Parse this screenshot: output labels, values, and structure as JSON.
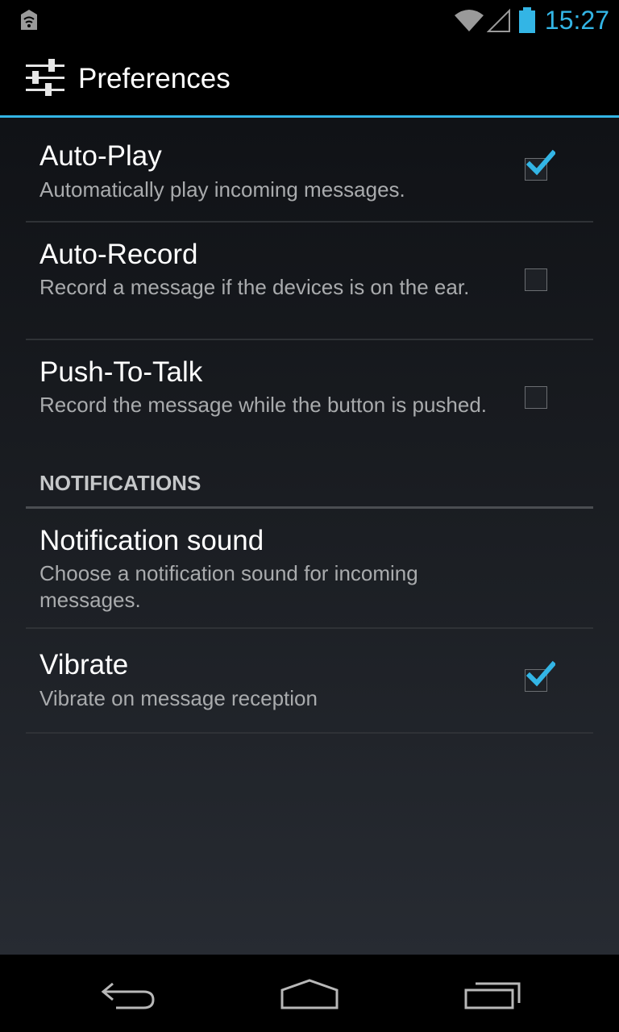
{
  "status_bar": {
    "time": "15:27",
    "accent_color": "#33b5e5",
    "icons": [
      "notification-app-icon",
      "wifi-icon",
      "signal-icon",
      "battery-icon"
    ]
  },
  "action_bar": {
    "title": "Preferences",
    "icon": "sliders-icon"
  },
  "preferences": {
    "items": [
      {
        "title": "Auto-Play",
        "summary": "Automatically play incoming messages.",
        "checked": true
      },
      {
        "title": "Auto-Record",
        "summary": "Record a message if the devices is on the ear.",
        "checked": false
      },
      {
        "title": "Push-To-Talk",
        "summary": "Record the message while the button is pushed.",
        "checked": false
      }
    ],
    "section_header": "NOTIFICATIONS",
    "notification_items": [
      {
        "title": "Notification sound",
        "summary": "Choose a notification sound for incoming messages."
      },
      {
        "title": "Vibrate",
        "summary": "Vibrate on message reception",
        "checked": true
      }
    ]
  },
  "nav_bar": {
    "icons": [
      "back-icon",
      "home-icon",
      "recent-apps-icon"
    ]
  }
}
